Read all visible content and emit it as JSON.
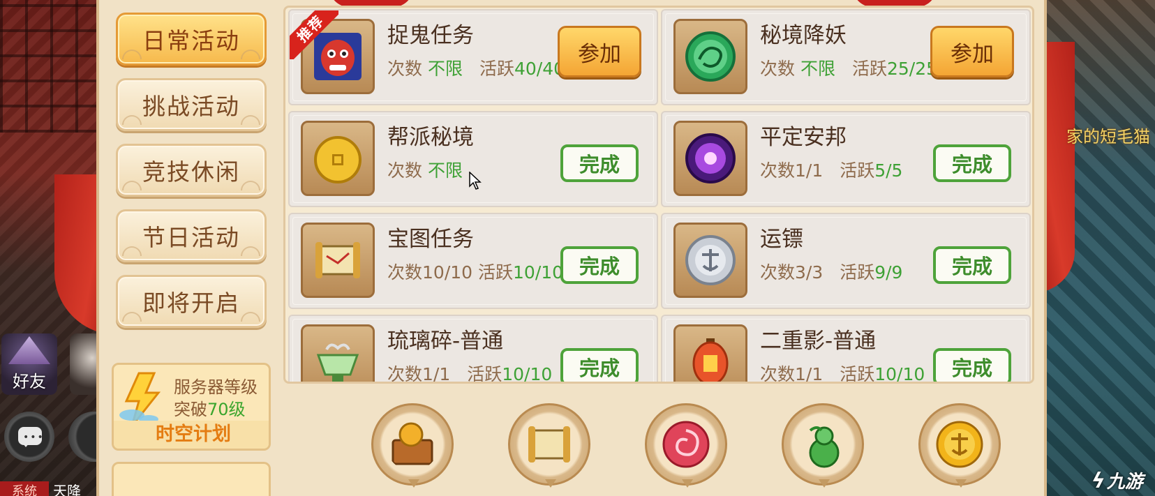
{
  "tabs": [
    {
      "label": "日常活动",
      "active": true
    },
    {
      "label": "挑战活动",
      "active": false
    },
    {
      "label": "竞技休闲",
      "active": false
    },
    {
      "label": "节日活动",
      "active": false
    },
    {
      "label": "即将开启",
      "active": false
    }
  ],
  "promo": {
    "line1": "服务器等级",
    "line2_prefix": "突破",
    "line2_level": "70级",
    "plan": "时空计划"
  },
  "activities": [
    {
      "title": "捉鬼任务",
      "count_label": "次数",
      "count": "不限",
      "active_label": "活跃",
      "active": "40/40",
      "action": "参加",
      "recommended": true,
      "recommend_label": "推荐",
      "icon": "ghost-mask-icon"
    },
    {
      "title": "秘境降妖",
      "count_label": "次数",
      "count": "不限",
      "active_label": "活跃",
      "active": "25/25",
      "action": "参加",
      "recommended": false,
      "icon": "jade-dragon-icon"
    },
    {
      "title": "帮派秘境",
      "count_label": "次数",
      "count": "不限",
      "active_label": "",
      "active": "",
      "action": "完成",
      "recommended": false,
      "icon": "gold-coin-icon"
    },
    {
      "title": "平定安邦",
      "count_label": "次数",
      "count": "1/1",
      "active_label": "活跃",
      "active": "5/5",
      "action": "完成",
      "recommended": false,
      "icon": "purple-orb-icon"
    },
    {
      "title": "宝图任务",
      "count_label": "次数",
      "count": "10/10",
      "active_label": "活跃",
      "active": "10/10",
      "action": "完成",
      "recommended": false,
      "icon": "treasure-scroll-icon"
    },
    {
      "title": "运镖",
      "count_label": "次数",
      "count": "3/3",
      "active_label": "活跃",
      "active": "9/9",
      "action": "完成",
      "recommended": false,
      "icon": "silver-coin-icon"
    },
    {
      "title": "琉璃碎-普通",
      "count_label": "次数",
      "count": "1/1",
      "active_label": "活跃",
      "active": "10/10",
      "action": "完成",
      "recommended": false,
      "icon": "glass-bowl-icon"
    },
    {
      "title": "二重影-普通",
      "count_label": "次数",
      "count": "1/1",
      "active_label": "活跃",
      "active": "10/10",
      "action": "完成",
      "recommended": false,
      "icon": "lantern-icon"
    }
  ],
  "rewards": [
    "treasure-chest-icon",
    "scroll-reward-icon",
    "spiral-orb-icon",
    "gourd-icon",
    "gold-dream-coin-icon"
  ],
  "game_hud": {
    "friend_label": "好友",
    "system_tag": "系统",
    "system_text": "天降",
    "world_text": "家的短毛猫"
  },
  "watermark": {
    "text": "九游"
  },
  "colors": {
    "green": "#3ea135",
    "join_button": "#f4a534",
    "done_border": "#4ea33a",
    "active_tab": "#f6b94c"
  }
}
